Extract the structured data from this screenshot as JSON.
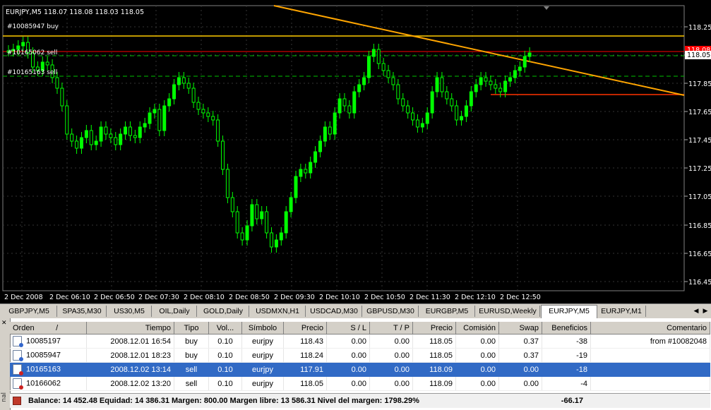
{
  "chart": {
    "symbol_header": "EURJPY,M5  118.07 118.08 118.03 118.05",
    "price_labels": [
      "118.25",
      "118.05",
      "117.85",
      "117.65",
      "117.45",
      "117.25",
      "117.05",
      "116.85",
      "116.65",
      "116.45"
    ],
    "current_price": "118.05",
    "red_price_label": "118.08",
    "time_labels": [
      "2 Dec 2008",
      "2 Dec 06:10",
      "2 Dec 06:50",
      "2 Dec 07:30",
      "2 Dec 08:10",
      "2 Dec 08:50",
      "2 Dec 09:30",
      "2 Dec 10:10",
      "2 Dec 10:50",
      "2 Dec 11:30",
      "2 Dec 12:10",
      "2 Dec 12:50"
    ],
    "order_labels": [
      "#10085947 buy",
      "#10165062 sell",
      "#10165163 sell"
    ],
    "colors": {
      "background": "#000000",
      "candle": "#00ff00",
      "bid": "#ffcc00",
      "order_line": "#ff0000",
      "trendline": "#ffa500",
      "grid": "#333333",
      "stop_line": "#00c000"
    }
  },
  "tabs": [
    "GBPJPY,M5",
    "SPA35,M30",
    "US30,M5",
    "OIL,Daily",
    "GOLD,Daily",
    "USDMXN,H1",
    "USDCAD,M30",
    "GBPUSD,M30",
    "EURGBP,M5",
    "EURUSD,Weekly",
    "EURJPY,M5",
    "EURJPY,M1"
  ],
  "active_tab": "EURJPY,M5",
  "terminal": {
    "side_label": "nal",
    "columns": [
      "Orden",
      "/",
      "Tiempo",
      "Tipo",
      "Vol...",
      "Símbolo",
      "Precio",
      "S / L",
      "T / P",
      "Precio",
      "Comisión",
      "Swap",
      "Beneficios",
      "Comentario"
    ],
    "rows": [
      {
        "order": "10085197",
        "time": "2008.12.01 16:54",
        "type": "buy",
        "vol": "0.10",
        "symbol": "eurjpy",
        "price": "118.43",
        "sl": "0.00",
        "tp": "0.00",
        "cur": "118.05",
        "comm": "0.00",
        "swap": "0.37",
        "profit": "-38",
        "comment": "from #10082048",
        "icon": "buy",
        "selected": false
      },
      {
        "order": "10085947",
        "time": "2008.12.01 18:23",
        "type": "buy",
        "vol": "0.10",
        "symbol": "eurjpy",
        "price": "118.24",
        "sl": "0.00",
        "tp": "0.00",
        "cur": "118.05",
        "comm": "0.00",
        "swap": "0.37",
        "profit": "-19",
        "comment": "",
        "icon": "buy",
        "selected": false
      },
      {
        "order": "10165163",
        "time": "2008.12.02 13:14",
        "type": "sell",
        "vol": "0.10",
        "symbol": "eurjpy",
        "price": "117.91",
        "sl": "0.00",
        "tp": "0.00",
        "cur": "118.09",
        "comm": "0.00",
        "swap": "0.00",
        "profit": "-18",
        "comment": "",
        "icon": "sell",
        "selected": true
      },
      {
        "order": "10166062",
        "time": "2008.12.02 13:20",
        "type": "sell",
        "vol": "0.10",
        "symbol": "eurjpy",
        "price": "118.05",
        "sl": "0.00",
        "tp": "0.00",
        "cur": "118.09",
        "comm": "0.00",
        "swap": "0.00",
        "profit": "-4",
        "comment": "",
        "icon": "sell",
        "selected": false
      }
    ],
    "balance_text": "Balance: 14 452.48  Equidad: 14 386.31  Margen: 800.00  Margen libre: 13 586.31  Nivel del margen: 1798.29%",
    "total_profit": "-66.17"
  }
}
